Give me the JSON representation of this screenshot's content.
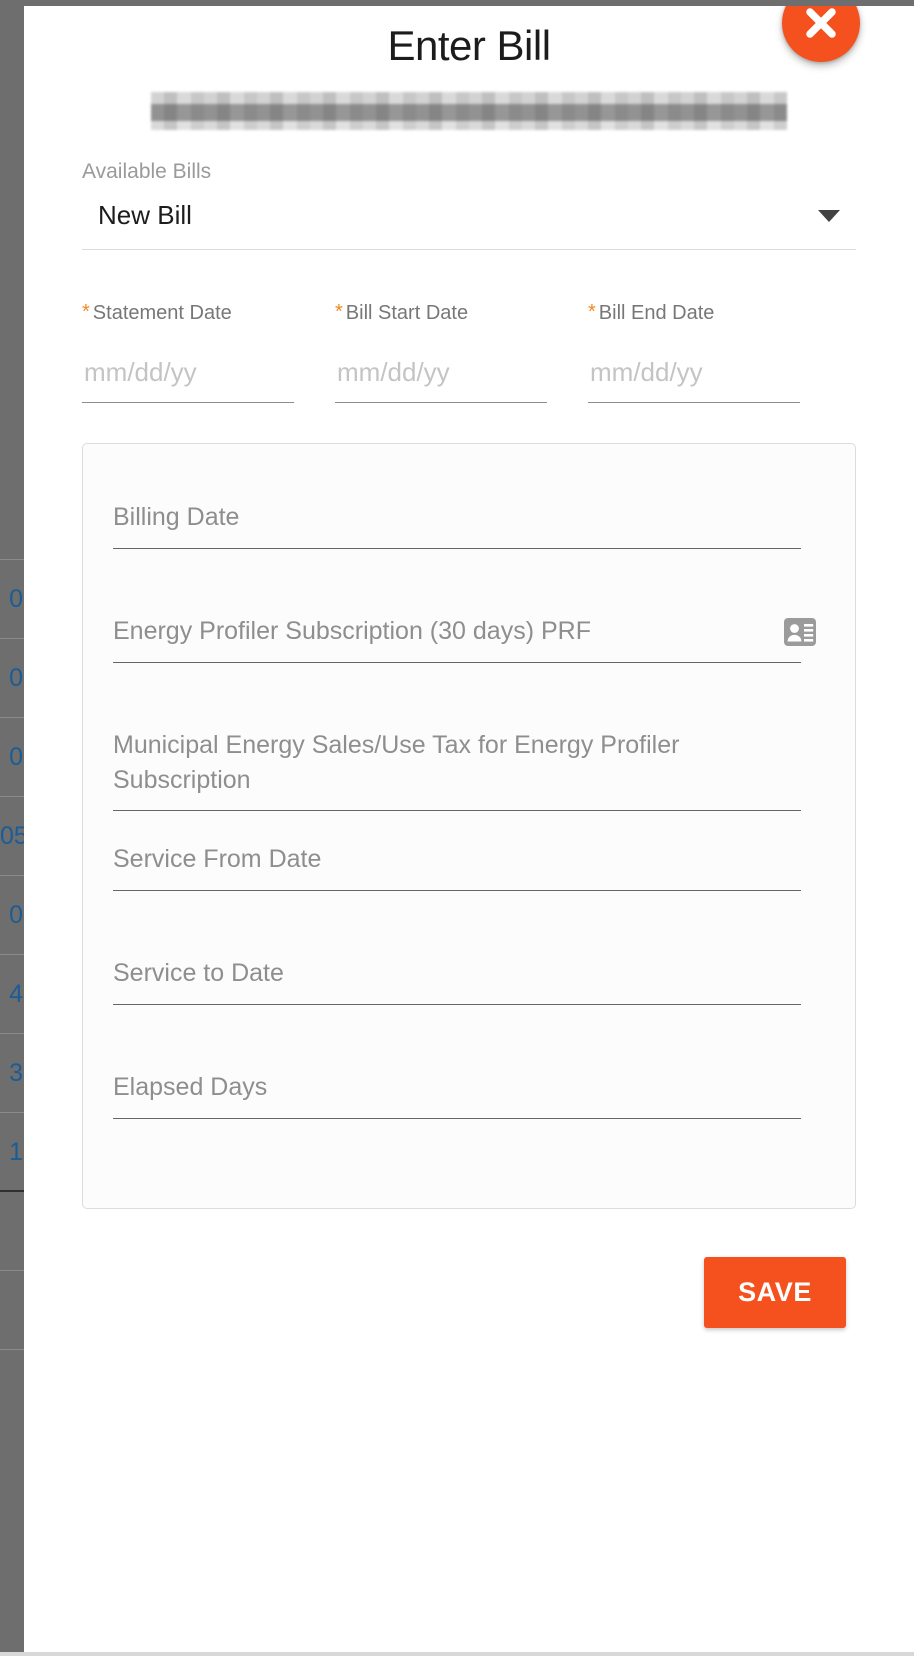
{
  "backdrop": {
    "table_numbers": [
      "0",
      "0",
      "0",
      "05",
      "0",
      "4",
      "3",
      "1"
    ]
  },
  "modal": {
    "title": "Enter Bill",
    "close_label": "close-icon",
    "redacted_note": "",
    "available_bills": {
      "label": "Available Bills",
      "selected": "New Bill",
      "options": [
        "New Bill"
      ]
    },
    "date_fields": [
      {
        "label": "Statement Date",
        "required_marker": "*",
        "placeholder": "mm/dd/yy",
        "value": ""
      },
      {
        "label": "Bill Start Date",
        "required_marker": "*",
        "placeholder": "mm/dd/yy",
        "value": ""
      },
      {
        "label": "Bill End Date",
        "required_marker": "*",
        "placeholder": "mm/dd/yy",
        "value": ""
      }
    ],
    "card_fields": [
      {
        "label": "Billing Date",
        "value": "",
        "icon": "",
        "two_line": false
      },
      {
        "label": "Energy Profiler Subscription (30 days) PRF",
        "value": "",
        "icon": "contact-card-icon",
        "two_line": false
      },
      {
        "label": "Municipal Energy Sales/Use Tax for Energy Profiler Subscription",
        "value": "",
        "icon": "",
        "two_line": true
      },
      {
        "label": "Service From Date",
        "value": "",
        "icon": "",
        "two_line": false
      },
      {
        "label": "Service to Date",
        "value": "",
        "icon": "",
        "two_line": false
      },
      {
        "label": "Elapsed Days",
        "value": "",
        "icon": "",
        "two_line": false
      }
    ],
    "save_label": "SAVE"
  },
  "colors": {
    "accent_orange": "#F4511E",
    "required_orange": "#F4871E",
    "label_gray": "#8E8E8E",
    "backdrop_gray": "#6E6E6E",
    "table_blue": "#1A5D96"
  }
}
